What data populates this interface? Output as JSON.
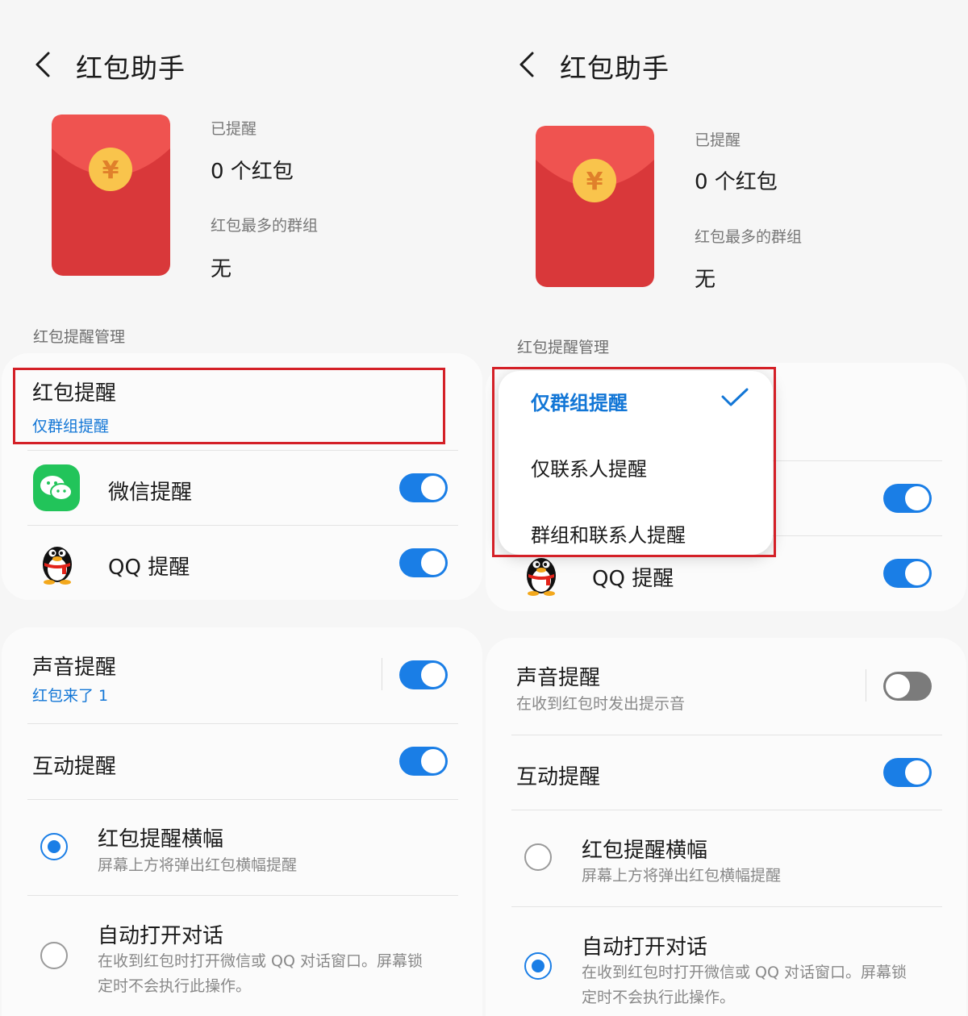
{
  "left": {
    "title": "红包助手",
    "stats": {
      "reminded_label": "已提醒",
      "reminded_value": "0 个红包",
      "top_group_label": "红包最多的群组",
      "top_group_value": "无"
    },
    "section_label": "红包提醒管理",
    "reminder": {
      "title": "红包提醒",
      "value": "仅群组提醒"
    },
    "apps": [
      {
        "label": "微信提醒",
        "on": true
      },
      {
        "label": "QQ 提醒",
        "on": true
      }
    ],
    "sound": {
      "title": "声音提醒",
      "sub": "红包来了 1",
      "on": true
    },
    "interactive": {
      "title": "互动提醒",
      "on": true
    },
    "options": [
      {
        "title": "红包提醒横幅",
        "desc": "屏幕上方将弹出红包横幅提醒",
        "selected": true
      },
      {
        "title": "自动打开对话",
        "desc_line1": "在收到红包时打开微信或 QQ 对话窗口。屏幕锁",
        "desc_line2": "定时不会执行此操作。",
        "selected": false
      }
    ]
  },
  "right": {
    "title": "红包助手",
    "stats": {
      "reminded_label": "已提醒",
      "reminded_value": "0 个红包",
      "top_group_label": "红包最多的群组",
      "top_group_value": "无"
    },
    "section_label": "红包提醒管理",
    "menu": {
      "items": [
        "仅群组提醒",
        "仅联系人提醒",
        "群组和联系人提醒"
      ],
      "selected_index": 0
    },
    "qq_label": "QQ 提醒",
    "sound": {
      "title": "声音提醒",
      "sub": "在收到红包时发出提示音",
      "on": false
    },
    "interactive": {
      "title": "互动提醒",
      "on": true
    },
    "options": [
      {
        "title": "红包提醒横幅",
        "desc": "屏幕上方将弹出红包横幅提醒",
        "selected": false
      },
      {
        "title": "自动打开对话",
        "desc_line1": "在收到红包时打开微信或 QQ 对话窗口。屏幕锁",
        "desc_line2": "定时不会执行此操作。",
        "selected": true
      }
    ]
  },
  "colors": {
    "accent": "#1a7ee6",
    "link_blue": "#1276d6",
    "highlight_red": "#d42027",
    "envelope_red": "#d9383a",
    "envelope_flap": "#ef5350",
    "coin_gold": "#f9c44c",
    "wechat_green": "#22c45a"
  },
  "icons": [
    "back-arrow-icon",
    "red-envelope-icon",
    "wechat-icon",
    "qq-penguin-icon",
    "checkmark-icon"
  ]
}
